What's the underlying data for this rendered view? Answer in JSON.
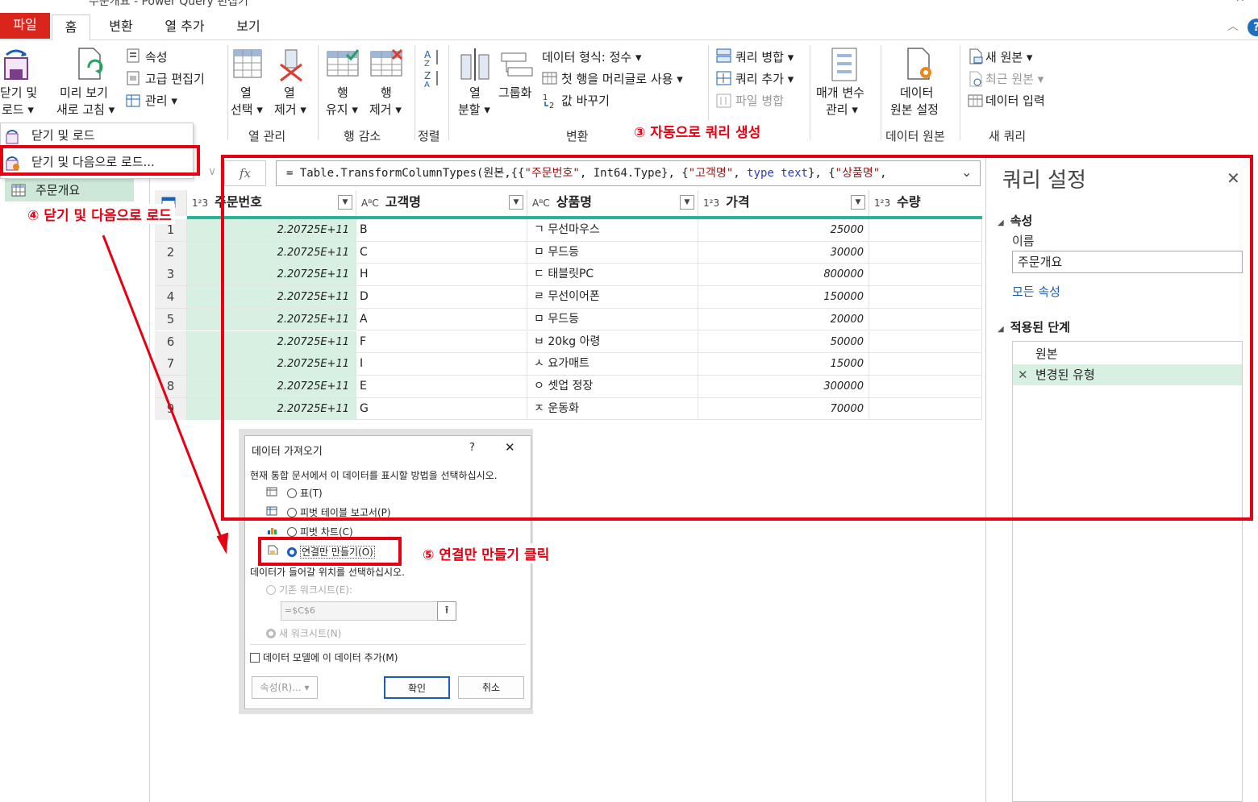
{
  "window": {
    "title": "주문개요 - Power Query 편집기",
    "controls": [
      "–",
      "☐",
      "✕"
    ]
  },
  "menu": {
    "tabs": [
      "파일",
      "홈",
      "변환",
      "열 추가",
      "보기"
    ],
    "help": "?"
  },
  "ribbon": {
    "close_load": [
      "닫기 및",
      "로드 ▾"
    ],
    "refresh": [
      "미리 보기",
      "새로 고침 ▾"
    ],
    "properties": "속성",
    "advanced_editor": "고급 편집기",
    "manage": "관리 ▾",
    "choose_columns": [
      "열",
      "선택 ▾"
    ],
    "remove_columns": [
      "열",
      "제거 ▾"
    ],
    "keep_rows": [
      "행",
      "유지 ▾"
    ],
    "remove_rows": [
      "행",
      "제거 ▾"
    ],
    "split_column": [
      "열",
      "분할 ▾"
    ],
    "group_by": "그룹화",
    "data_type": "데이터 형식: 정수 ▾",
    "first_row_header": "첫 행을 머리글로 사용 ▾",
    "replace_values": "값 바꾸기",
    "merge_queries": "쿼리 병합 ▾",
    "append_queries": "쿼리 추가 ▾",
    "combine_files": "파일 병합",
    "manage_params": [
      "매개 변수",
      "관리 ▾"
    ],
    "data_source_settings": [
      "데이터",
      "원본 설정"
    ],
    "new_source": "새 원본 ▾",
    "recent_sources": "최근 원본 ▾",
    "enter_data": "데이터 입력",
    "groups": {
      "columns": "열 관리",
      "rows": "행 감소",
      "sort": "정렬",
      "transform": "변환",
      "data_sources": "데이터 원본",
      "new_query": "새 쿼리"
    }
  },
  "dropdown": {
    "items": [
      "닫기 및 로드",
      "닫기 및 다음으로 로드..."
    ]
  },
  "queries": {
    "items": [
      "주문개요"
    ]
  },
  "formula": {
    "fx": "fx",
    "p1": "= Table.TransformColumnTypes(원본,{{",
    "s1": "\"주문번호\"",
    "p2": ", Int64.Type}, {",
    "s2": "\"고객명\"",
    "p3": ", ",
    "k1": "type text",
    "p4": "}, {",
    "s3": "\"상품명\"",
    "p5": ","
  },
  "table": {
    "columns": [
      {
        "type": "1²3",
        "name": "주문번호"
      },
      {
        "type": "AᴮC",
        "name": "고객명"
      },
      {
        "type": "AᴮC",
        "name": "상품명"
      },
      {
        "type": "1²3",
        "name": "가격"
      },
      {
        "type": "1²3",
        "name": "수량"
      }
    ],
    "rows": [
      {
        "n": "1",
        "id": "2.20725E+11",
        "cust": "B",
        "prod": "ㄱ 무선마우스",
        "price": "25000"
      },
      {
        "n": "2",
        "id": "2.20725E+11",
        "cust": "C",
        "prod": "ㅁ 무드등",
        "price": "30000"
      },
      {
        "n": "3",
        "id": "2.20725E+11",
        "cust": "H",
        "prod": "ㄷ 태블릿PC",
        "price": "800000"
      },
      {
        "n": "4",
        "id": "2.20725E+11",
        "cust": "D",
        "prod": "ㄹ 무선이어폰",
        "price": "150000"
      },
      {
        "n": "5",
        "id": "2.20725E+11",
        "cust": "A",
        "prod": "ㅁ 무드등",
        "price": "20000"
      },
      {
        "n": "6",
        "id": "2.20725E+11",
        "cust": "F",
        "prod": "ㅂ 20kg 아령",
        "price": "50000"
      },
      {
        "n": "7",
        "id": "2.20725E+11",
        "cust": "I",
        "prod": "ㅅ 요가매트",
        "price": "15000"
      },
      {
        "n": "8",
        "id": "2.20725E+11",
        "cust": "E",
        "prod": "ㅇ 셋업 정장",
        "price": "300000"
      },
      {
        "n": "9",
        "id": "2.20725E+11",
        "cust": "G",
        "prod": "ㅈ 운동화",
        "price": "70000"
      }
    ]
  },
  "settings": {
    "title": "쿼리 설정",
    "properties": "속성",
    "name_label": "이름",
    "name_value": "주문개요",
    "all_properties": "모든 속성",
    "applied_steps": "적용된 단계",
    "steps": [
      "원본",
      "변경된 유형"
    ]
  },
  "dialog": {
    "title": "데이터 가져오기",
    "help": "?",
    "prompt": "현재 통합 문서에서 이 데이터를 표시할 방법을 선택하십시오.",
    "opt_table": "표(T)",
    "opt_pivot_table": "피벗 테이블 보고서(P)",
    "opt_pivot_chart": "피벗 차트(C)",
    "opt_connection": "연결만 만들기(O)",
    "location_prompt": "데이터가 들어갈 위치를 선택하십시오.",
    "existing_sheet": "기존 워크시트(E):",
    "cell_ref": "=$C$6",
    "new_sheet": "새 워크시트(N)",
    "add_model": "데이터 모델에 이 데이터 추가(M)",
    "props_btn": "속성(R)... ▾",
    "ok": "확인",
    "cancel": "취소"
  },
  "annotations": {
    "step3": "③ 자동으로 쿼리 생성",
    "step4": "④ 닫기 및 다음으로 로드",
    "step5": "⑤ 연결만 만들기 클릭"
  },
  "colors": {
    "annotation_red": "#e60012",
    "file_tab": "#d9251c",
    "accent_teal": "#28b49a",
    "selection_green": "#d8f0e2"
  }
}
